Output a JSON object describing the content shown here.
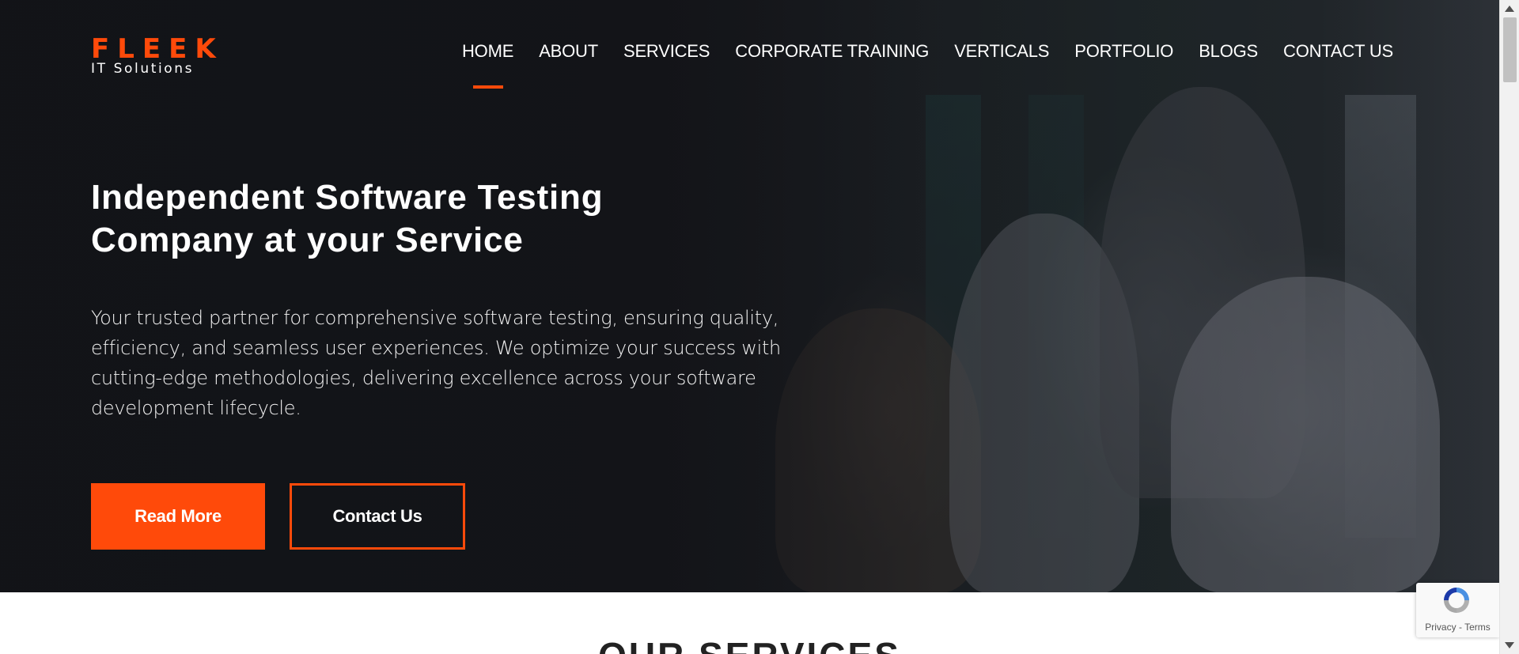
{
  "brand": {
    "name": "FLEEK",
    "tagline": "IT Solutions",
    "accent_color": "#ff4a0a"
  },
  "nav": {
    "items": [
      {
        "label": "HOME",
        "active": true
      },
      {
        "label": "ABOUT",
        "active": false
      },
      {
        "label": "SERVICES",
        "active": false
      },
      {
        "label": "CORPORATE TRAINING",
        "active": false
      },
      {
        "label": "VERTICALS",
        "active": false
      },
      {
        "label": "PORTFOLIO",
        "active": false
      },
      {
        "label": "BLOGS",
        "active": false
      },
      {
        "label": "CONTACT US",
        "active": false
      }
    ]
  },
  "hero": {
    "title_line1": "Independent Software Testing",
    "title_line2": "Company at your Service",
    "description": "Your trusted partner for comprehensive software testing, ensuring quality, efficiency, and seamless user experiences. We optimize your success with cutting-edge methodologies, delivering excellence across your software development lifecycle.",
    "primary_button": "Read More",
    "secondary_button": "Contact Us"
  },
  "services": {
    "title": "OUR SERVICES"
  },
  "recaptcha": {
    "privacy": "Privacy",
    "separator": "-",
    "terms": "Terms",
    "icon": "recaptcha-logo-icon"
  }
}
